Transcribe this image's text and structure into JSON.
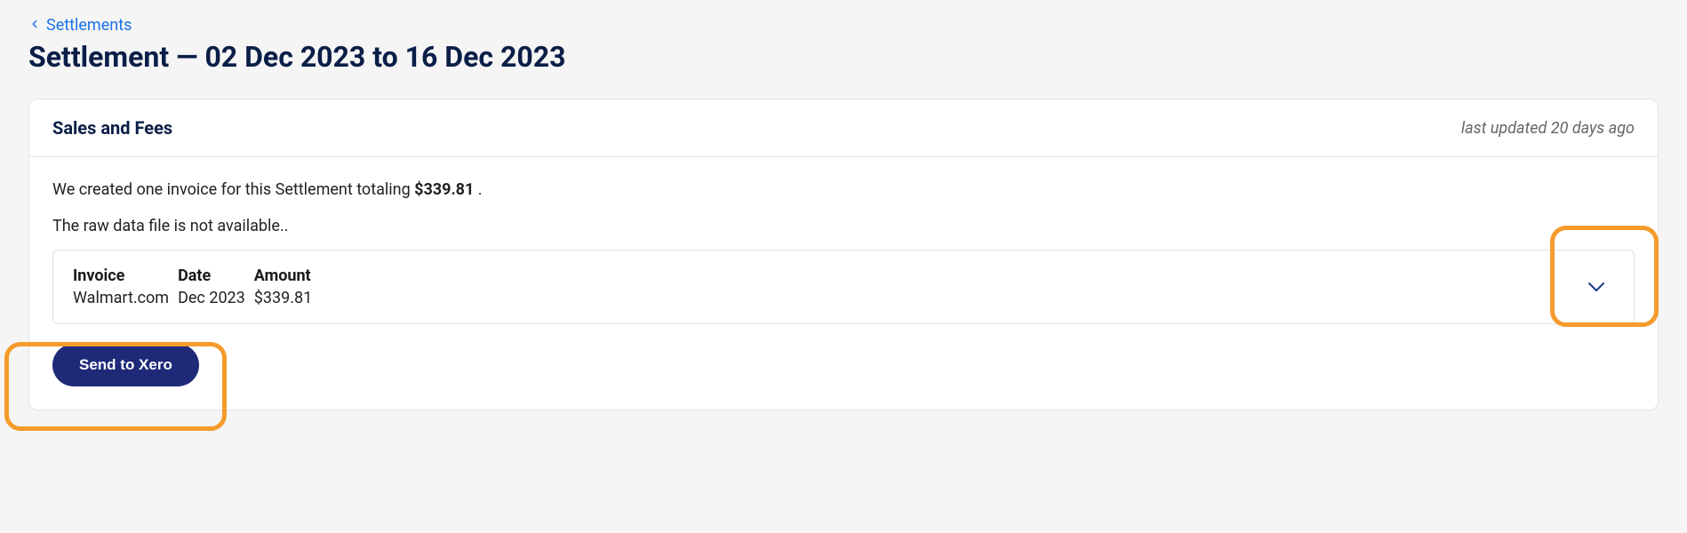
{
  "breadcrumb": {
    "label": "Settlements"
  },
  "page": {
    "title": "Settlement — 02 Dec 2023 to 16 Dec 2023"
  },
  "card": {
    "title": "Sales and Fees",
    "updated": "last updated 20 days ago",
    "summary_prefix": "We created one invoice for this Settlement totaling ",
    "summary_amount": "$339.81",
    "summary_suffix": " .",
    "raw_data_text": "The raw data file is not available..",
    "invoice": {
      "headers": {
        "invoice": "Invoice",
        "date": "Date",
        "amount": "Amount"
      },
      "row": {
        "invoice": "Walmart.com",
        "date": "Dec 2023",
        "amount": "$339.81"
      }
    },
    "button": {
      "send": "Send to Xero"
    }
  }
}
